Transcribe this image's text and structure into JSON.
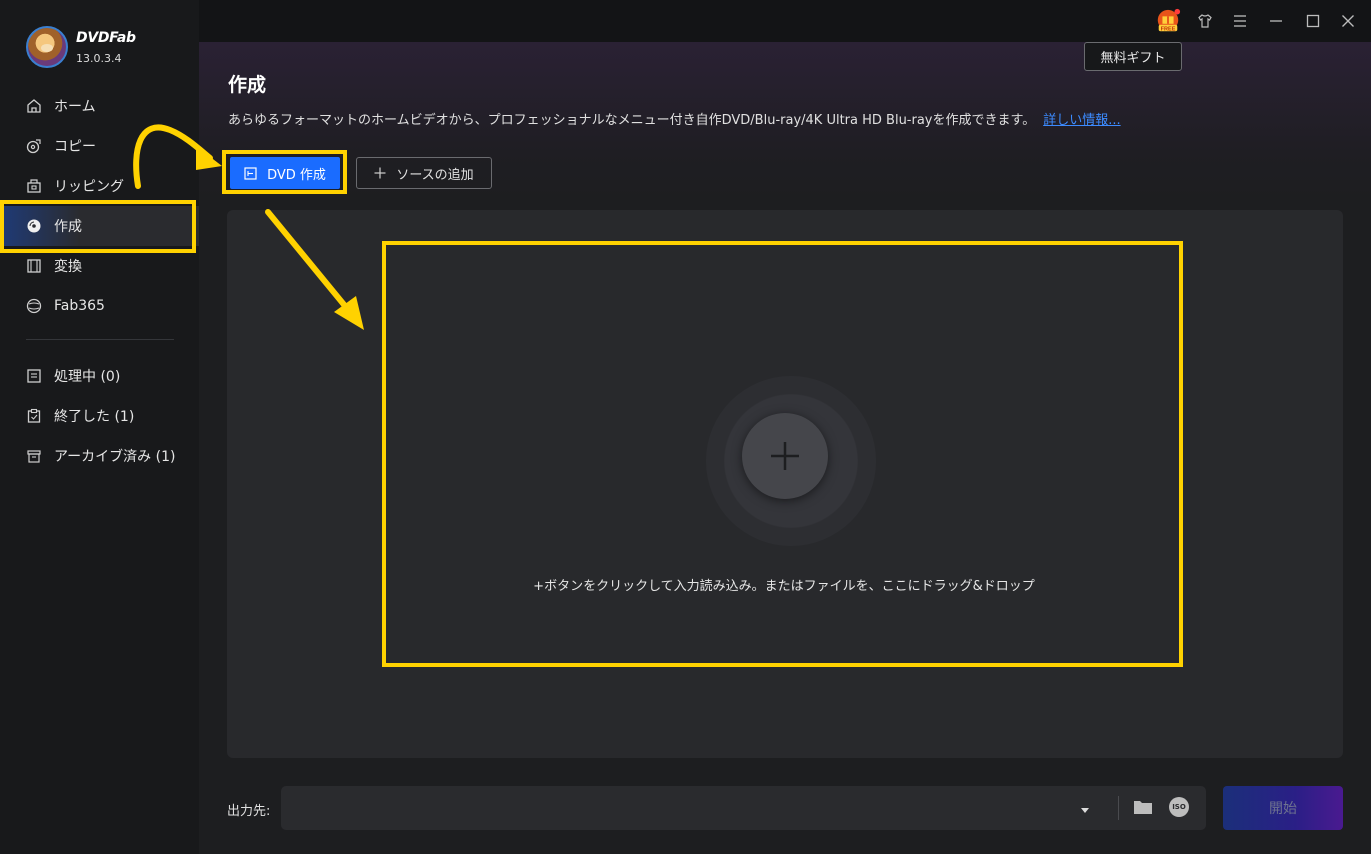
{
  "app": {
    "name": "DVDFab",
    "version": "13.0.3.4"
  },
  "sidebar": {
    "items": [
      {
        "label": "ホーム",
        "icon": "home-icon"
      },
      {
        "label": "コピー",
        "icon": "copy-icon"
      },
      {
        "label": "リッピング",
        "icon": "ripper-icon"
      },
      {
        "label": "作成",
        "icon": "creator-disc-icon",
        "active": true
      },
      {
        "label": "変換",
        "icon": "film-icon"
      },
      {
        "label": "Fab365",
        "icon": "fab365-icon"
      }
    ],
    "tasks": [
      {
        "label": "処理中 (0)",
        "icon": "queue-icon"
      },
      {
        "label": "終了した (1)",
        "icon": "finished-icon"
      },
      {
        "label": "アーカイブ済み (1)",
        "icon": "archive-icon"
      }
    ]
  },
  "titlebar": {
    "free_badge": "FREE",
    "gift_label": "無料ギフト"
  },
  "main": {
    "title": "作成",
    "description": "あらゆるフォーマットのホームビデオから、プロフェッショナルなメニュー付き自作DVD/Blu-ray/4K Ultra HD Blu-rayを作成できます。",
    "more_link": "詳しい情報...",
    "dvd_button": "DVD 作成",
    "add_source_button": "ソースの追加",
    "drop_hint": "+ボタンをクリックして入力読み込み。またはファイルを、ここにドラッグ&ドロップ"
  },
  "footer": {
    "output_label": "出力先:",
    "output_value": "",
    "iso_label": "ISO",
    "start_button": "開始"
  },
  "colors": {
    "accent": "#1a6cff",
    "highlight": "#ffd200",
    "link": "#3c8bff"
  }
}
